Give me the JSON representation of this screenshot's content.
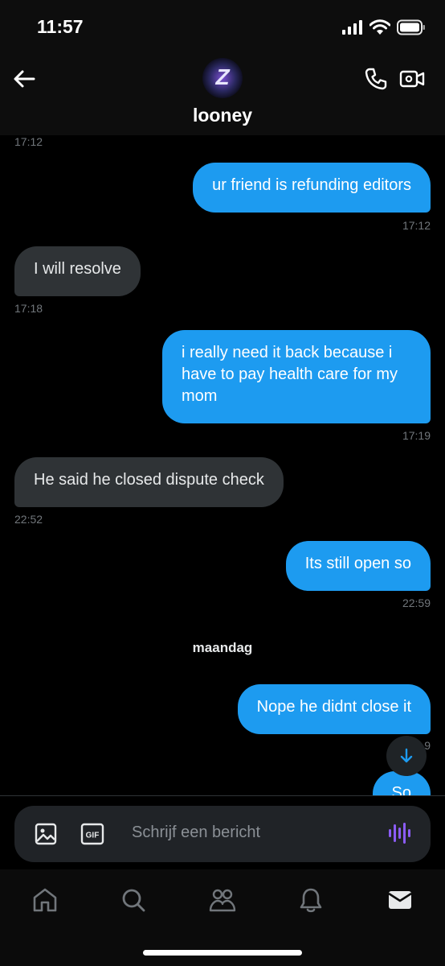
{
  "status_bar": {
    "time": "11:57"
  },
  "header": {
    "contact_name": "looney",
    "avatar_letter": "Z"
  },
  "messages": [
    {
      "id": "m0",
      "direction": "incoming",
      "time": "17:12"
    },
    {
      "id": "m1",
      "direction": "outgoing",
      "text": "ur friend is refunding editors",
      "time": "17:12"
    },
    {
      "id": "m2",
      "direction": "incoming",
      "text": "I will resolve",
      "time": "17:18"
    },
    {
      "id": "m3",
      "direction": "outgoing",
      "text": "i really need it back because i have to pay health care for my mom",
      "time": "17:19"
    },
    {
      "id": "m4",
      "direction": "incoming",
      "text": "He said he closed dispute check",
      "time": "22:52"
    },
    {
      "id": "m5",
      "direction": "outgoing",
      "text": "Its still open so",
      "time": "22:59"
    },
    {
      "id": "m6",
      "direction": "outgoing",
      "text": "Nope he didnt close it",
      "time": "…9"
    },
    {
      "id": "m7",
      "direction": "outgoing",
      "text": "So"
    }
  ],
  "day_separator": "maandag",
  "composer": {
    "placeholder": "Schrijf een bericht",
    "gif_label": "GIF"
  },
  "tabs": [
    "home",
    "search",
    "communities",
    "notifications",
    "messages"
  ],
  "colors": {
    "outgoing_bubble": "#1d9bf0",
    "incoming_bubble": "#2f3336",
    "background": "#000000",
    "voice_accent": "#8b5cf6"
  }
}
